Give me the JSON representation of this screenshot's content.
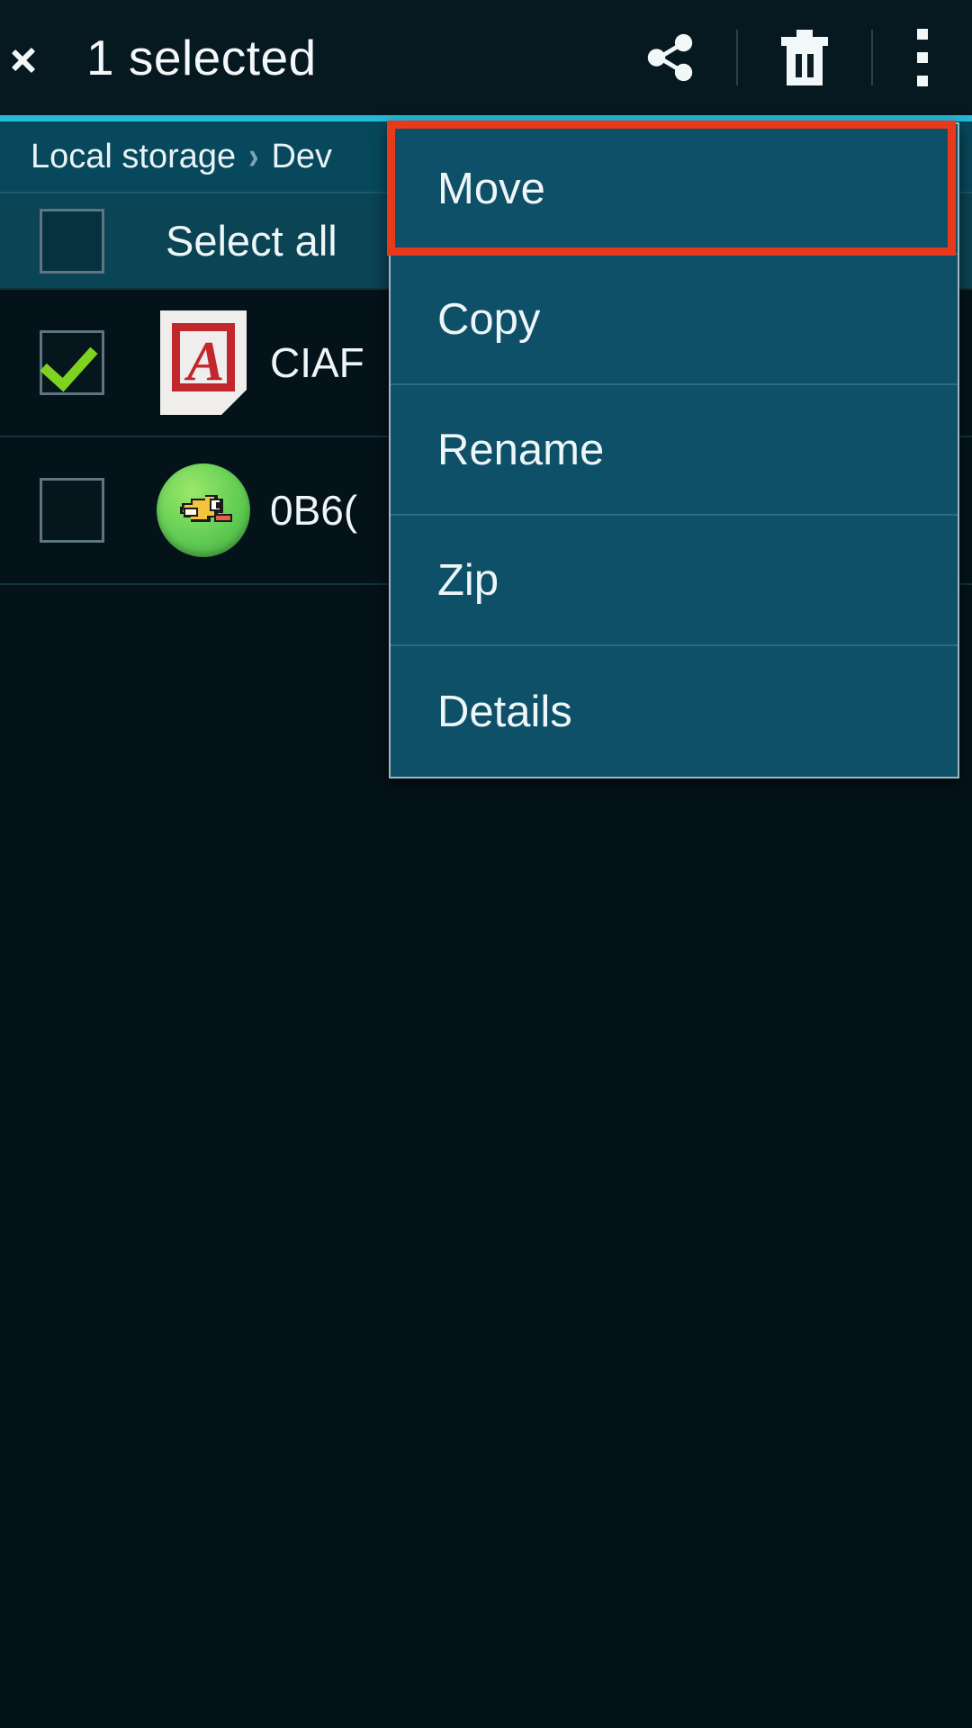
{
  "actionbar": {
    "title": "1 selected",
    "back_icon": "chevron-left-icon",
    "share_icon": "share-icon",
    "delete_icon": "trash-icon",
    "overflow_icon": "overflow-menu-icon"
  },
  "breadcrumb": {
    "items": [
      "Local storage",
      "Dev"
    ],
    "separator": "›"
  },
  "select_all": {
    "label": "Select all",
    "checked": false
  },
  "files": [
    {
      "name": "CIAF",
      "icon": "pdf-file-icon",
      "checked": true
    },
    {
      "name": "0B6(",
      "icon": "flappy-bird-app-icon",
      "checked": false
    }
  ],
  "popup_menu": {
    "items": [
      {
        "label": "Move"
      },
      {
        "label": "Copy"
      },
      {
        "label": "Rename"
      },
      {
        "label": "Zip"
      },
      {
        "label": "Details"
      }
    ],
    "highlighted_item": "Move"
  },
  "colors": {
    "background": "#041319",
    "actionbar": "#061820",
    "accent_rule": "#27b9d8",
    "breadcrumb_bar": "#07485c",
    "selectall_bar": "#0a4455",
    "menu_bg": "#0d5068",
    "menu_border": "#9fb6bd",
    "highlight": "#e8391b",
    "checkmark": "#7ed321",
    "text": "#eef6f8"
  }
}
